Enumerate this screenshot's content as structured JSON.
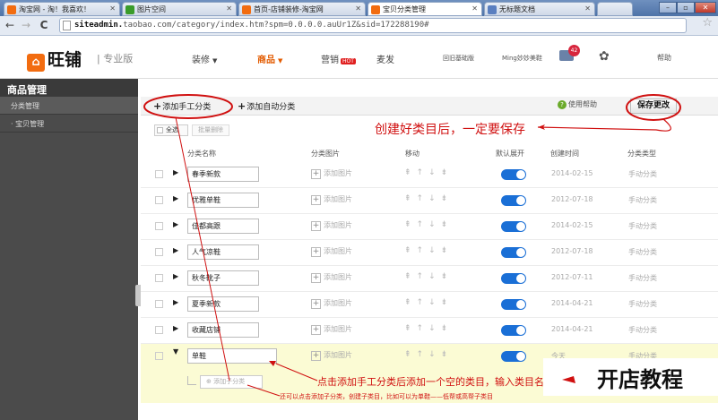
{
  "browser": {
    "tabs": [
      {
        "label": "淘宝网 - 淘！我喜欢！",
        "favicon_color": "#f26c10"
      },
      {
        "label": "图片空间",
        "favicon_color": "#3a9c2a"
      },
      {
        "label": "首页-店铺装修-淘宝网",
        "favicon_color": "#f26c10"
      },
      {
        "label": "宝贝分类管理",
        "favicon_color": "#f26c10"
      },
      {
        "label": "无标题文档",
        "favicon_color": "#5a7fc0"
      }
    ],
    "url_host": "siteadmin.",
    "url_rest": "taobao.com/category/index.htm?spm=0.0.0.0.auUr1Z&sid=172288190#"
  },
  "topnav": {
    "logo": "旺铺",
    "edition": "专业版",
    "menu": [
      {
        "label": "装修",
        "active": false,
        "caret": true
      },
      {
        "label": "商品",
        "active": true,
        "caret": true
      },
      {
        "label": "营销",
        "active": false,
        "caret": false,
        "badge": "HOT"
      },
      {
        "label": "麦发",
        "active": false,
        "caret": false
      }
    ],
    "link_basic": "回旧基础版",
    "link_shop": "Ming妙妙美鞋",
    "mail_count": "42",
    "help": "帮助"
  },
  "sidebar": {
    "title": "商品管理",
    "items": [
      {
        "label": "分类管理"
      },
      {
        "label": "宝贝管理"
      }
    ]
  },
  "toolbar": {
    "add_manual": "添加手工分类",
    "add_auto": "添加自动分类",
    "use_help": "使用帮助",
    "save": "保存更改",
    "select_all": "全选",
    "batch_delete": "批量删除"
  },
  "annotations": {
    "save_hint": "创建好类目后，一定要保存",
    "add_hint": "点击添加手工分类后添加一个空的类目，输入类目名",
    "sub_hint": "还可以点击添加子分类，创建子类目，比如可以为单鞋——低帮或高帮子类目",
    "watermark": "开店教程"
  },
  "table": {
    "headers": {
      "name": "分类名称",
      "image": "分类图片",
      "move": "移动",
      "expand": "默认展开",
      "created": "创建时间",
      "type": "分类类型"
    },
    "add_image_label": "添加图片",
    "move_glyphs": "⇞↑↓⇟",
    "rows": [
      {
        "name": "春季新款",
        "date": "2014-02-15",
        "type": "手动分类"
      },
      {
        "name": "优雅单鞋",
        "date": "2012-07-18",
        "type": "手动分类"
      },
      {
        "name": "佳都高跟",
        "date": "2014-02-15",
        "type": "手动分类"
      },
      {
        "name": "人气凉鞋",
        "date": "2012-07-18",
        "type": "手动分类"
      },
      {
        "name": "秋冬靴子",
        "date": "2012-07-11",
        "type": "手动分类"
      },
      {
        "name": "夏季新款",
        "date": "2014-04-21",
        "type": "手动分类"
      },
      {
        "name": "收藏店铺",
        "date": "2014-04-21",
        "type": "手动分类"
      },
      {
        "name": "单鞋",
        "date": "今天",
        "type": "手动分类"
      }
    ],
    "add_sub": "添加子分类"
  },
  "colors": {
    "accent": "#e35b00",
    "annotation": "#d01010",
    "toggle": "#1a6fd6",
    "sidebar": "#4b4b4b"
  }
}
